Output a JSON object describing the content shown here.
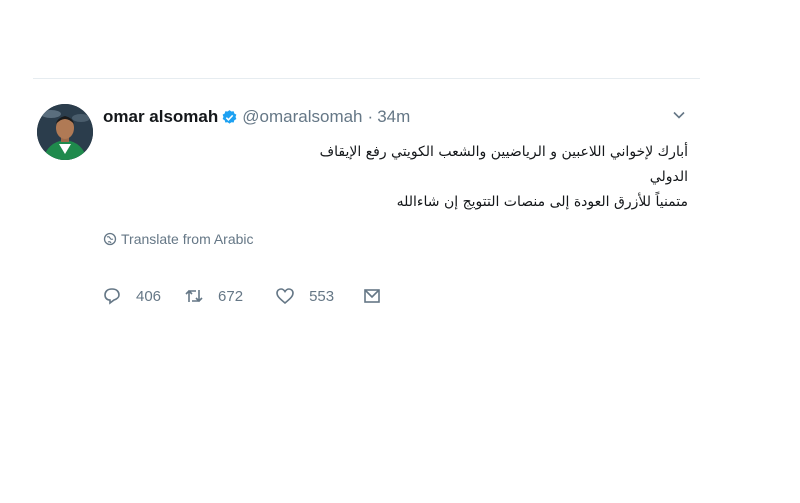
{
  "tweet": {
    "author_name": "omar alsomah",
    "handle": "@omaralsomah",
    "separator": "·",
    "time": "34m",
    "text_line1": "أبارك لإخواني اللاعبين و الرياضيين والشعب الكويتي رفع الإيقاف الدولي",
    "text_line2": "متمنياً للأزرق العودة إلى منصات التتويج إن شاءالله",
    "translate_label": "Translate from Arabic",
    "reply_count": "406",
    "retweet_count": "672",
    "like_count": "553"
  },
  "colors": {
    "text": "#14171a",
    "secondary": "#657786",
    "verified_badge": "#1da1f2",
    "divider": "#e6ecf0"
  },
  "icons": [
    "verified-badge-icon",
    "chevron-down-icon",
    "globe-icon",
    "reply-icon",
    "retweet-icon",
    "like-icon",
    "direct-message-icon"
  ]
}
